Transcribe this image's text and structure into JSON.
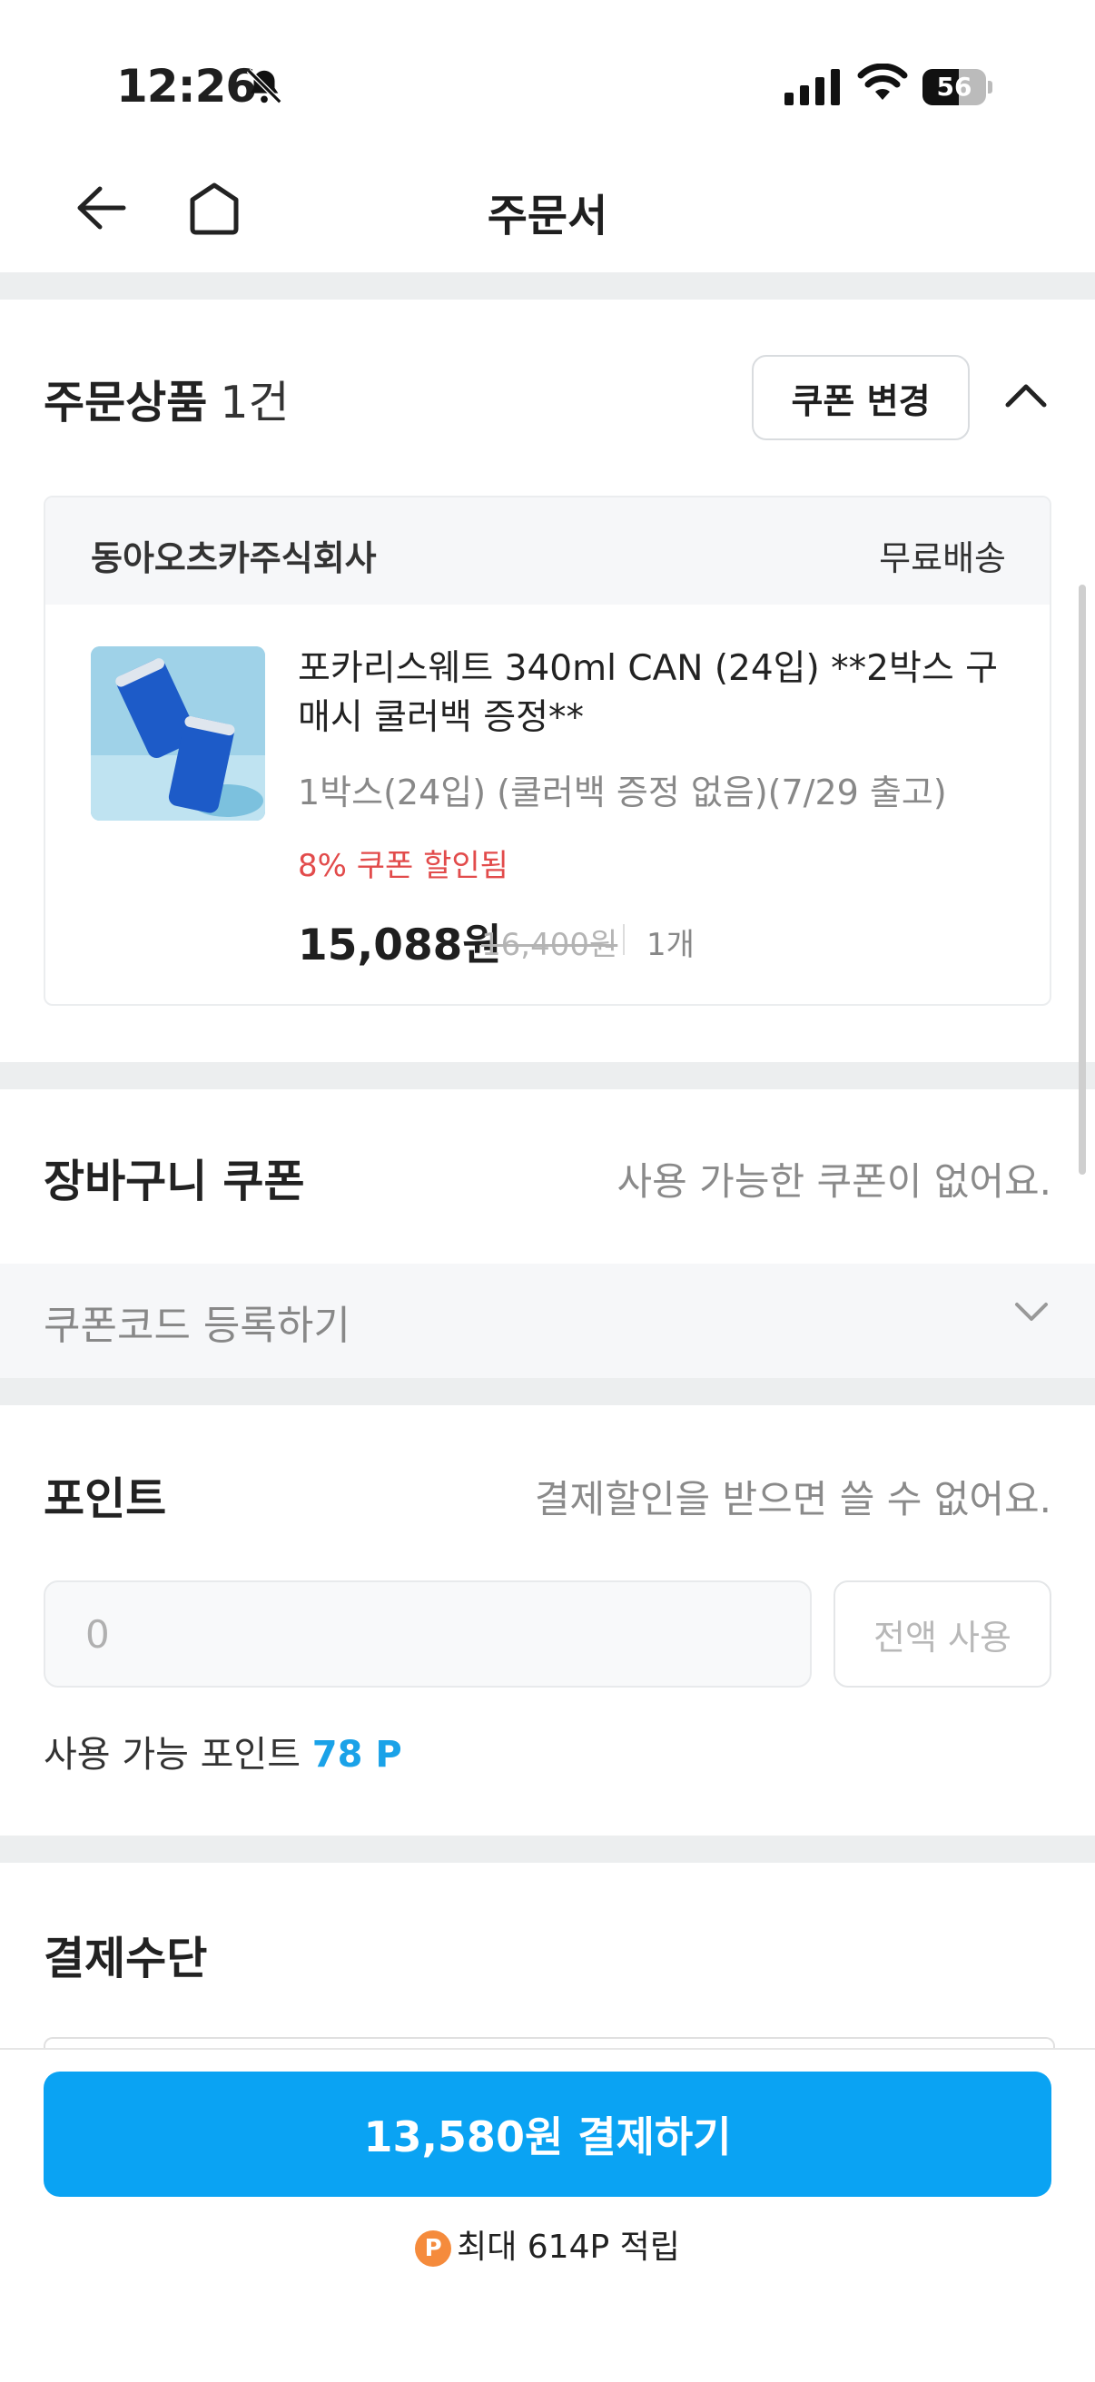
{
  "status_bar": {
    "time": "12:26",
    "battery": "56"
  },
  "header": {
    "title": "주문서"
  },
  "order_items": {
    "title": "주문상품",
    "count": "1건",
    "coupon_change_label": "쿠폰 변경",
    "seller": "동아오츠카주식회사",
    "shipping": "무료배송",
    "product": {
      "name": "포카리스웨트 340ml CAN (24입) **2박스 구매시 쿨러백 증정**",
      "option": "1박스(24입) (쿨러백 증정 없음)(7/29 출고)",
      "coupon_text": "8% 쿠폰 할인됨",
      "price": "15,088원",
      "original_price": "16,400원",
      "quantity": "1개"
    }
  },
  "cart_coupon": {
    "title": "장바구니 쿠폰",
    "message": "사용 가능한 쿠폰이 없어요.",
    "code_label": "쿠폰코드 등록하기"
  },
  "points": {
    "title": "포인트",
    "message": "결제할인을 받으면 쓸 수 없어요.",
    "input_value": "0",
    "use_all_label": "전액 사용",
    "available_label": "사용 가능 포인트",
    "available_value": "78 P"
  },
  "payment_method": {
    "title": "결제수단"
  },
  "bottom": {
    "pay_button": "13,580원 결제하기",
    "badge": "P",
    "reward_text": "최대 614P 적립"
  },
  "colors": {
    "accent": "#0aa3f3",
    "coupon_red": "#e24b4b",
    "points_blue": "#1aa2e8",
    "reward_orange": "#f58b3c"
  }
}
